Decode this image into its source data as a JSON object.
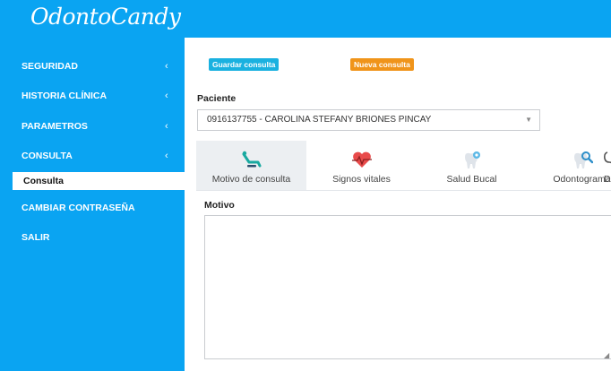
{
  "brand": {
    "logo": "OdontoCandy"
  },
  "sidebar": {
    "items": [
      {
        "label": "SEGURIDAD",
        "chevron": "‹"
      },
      {
        "label": "HISTORIA CLÍNICA",
        "chevron": "‹"
      },
      {
        "label": "PARAMETROS",
        "chevron": "‹"
      },
      {
        "label": "CONSULTA",
        "chevron": "‹"
      },
      {
        "label": "CAMBIAR CONTRASEÑA"
      },
      {
        "label": "SALIR"
      }
    ],
    "active_subitem": "Consulta"
  },
  "actions": {
    "save_label": "Guardar consulta",
    "new_label": "Nueva consulta"
  },
  "patient": {
    "label": "Paciente",
    "selected": "0916137755 - CAROLINA STEFANY BRIONES PINCAY"
  },
  "tabs": [
    {
      "label": "Motivo de consulta",
      "icon": "dental-chair-icon",
      "active": true
    },
    {
      "label": "Signos vitales",
      "icon": "heart-pulse-icon",
      "active": false
    },
    {
      "label": "Salud Bucal",
      "icon": "tooth-sparkle-icon",
      "active": false
    },
    {
      "label": "Odontograma",
      "icon": "tooth-search-icon",
      "active": false
    },
    {
      "label": "Diagn",
      "icon": "stethoscope-icon",
      "active": false
    }
  ],
  "motivo": {
    "label": "Motivo",
    "value": ""
  },
  "colors": {
    "primary": "#0aa4f2",
    "save_badge": "#1ab1e0",
    "new_badge": "#f0941a"
  }
}
